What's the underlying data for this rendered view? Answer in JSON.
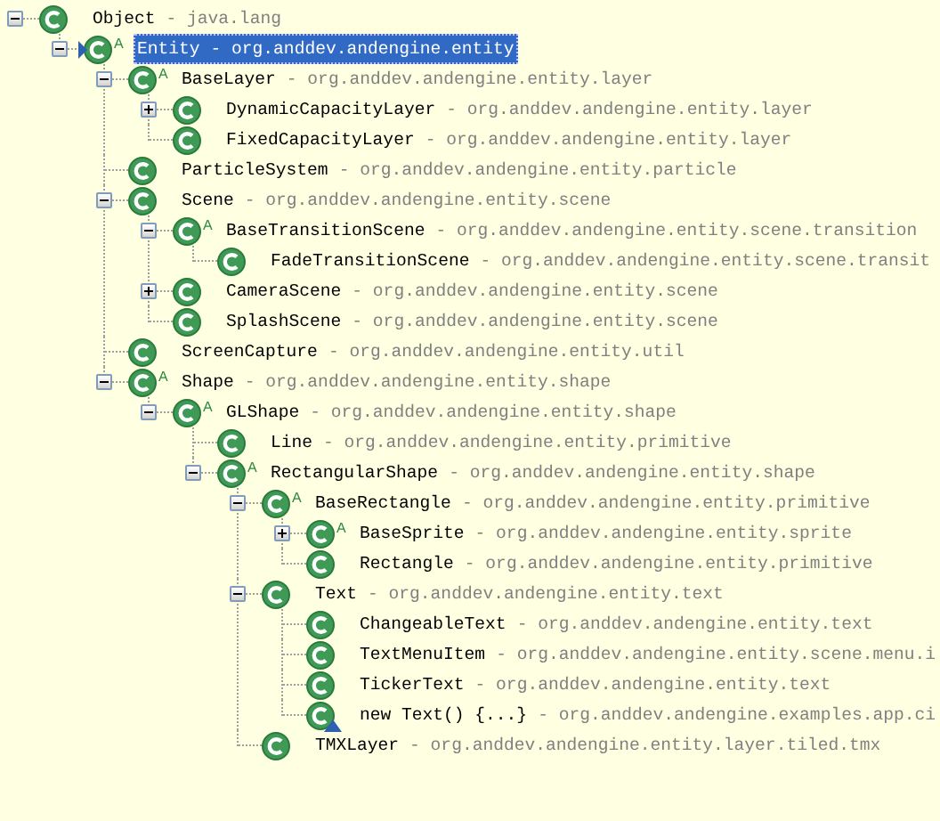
{
  "hierarchy": {
    "nodes": [
      {
        "name": "Object",
        "detail": "- java.lang",
        "kind": "class",
        "selected": false,
        "focused": false,
        "expanded": true,
        "children": [
          {
            "name": "Entity",
            "detail": "- org.anddev.andengine.entity",
            "kind": "class",
            "modifier": "A",
            "selected": true,
            "focused": true,
            "expanded": true,
            "children": [
              {
                "name": "BaseLayer",
                "detail": "- org.anddev.andengine.entity.layer",
                "kind": "class",
                "modifier": "A",
                "selected": false,
                "focused": false,
                "expanded": true,
                "children": [
                  {
                    "name": "DynamicCapacityLayer",
                    "detail": "- org.anddev.andengine.entity.layer",
                    "kind": "class",
                    "selected": false,
                    "focused": false,
                    "expanded": false
                  },
                  {
                    "name": "FixedCapacityLayer",
                    "detail": "- org.anddev.andengine.entity.layer",
                    "kind": "class",
                    "selected": false,
                    "focused": false
                  }
                ]
              },
              {
                "name": "ParticleSystem",
                "detail": "- org.anddev.andengine.entity.particle",
                "kind": "class",
                "selected": false,
                "focused": false
              },
              {
                "name": "Scene",
                "detail": "- org.anddev.andengine.entity.scene",
                "kind": "class",
                "selected": false,
                "focused": false,
                "expanded": true,
                "children": [
                  {
                    "name": "BaseTransitionScene",
                    "detail": "- org.anddev.andengine.entity.scene.transition",
                    "kind": "class",
                    "modifier": "A",
                    "selected": false,
                    "focused": false,
                    "expanded": true,
                    "children": [
                      {
                        "name": "FadeTransitionScene",
                        "detail": "- org.anddev.andengine.entity.scene.transit",
                        "kind": "class",
                        "selected": false,
                        "focused": false
                      }
                    ]
                  },
                  {
                    "name": "CameraScene",
                    "detail": "- org.anddev.andengine.entity.scene",
                    "kind": "class",
                    "selected": false,
                    "focused": false,
                    "expanded": false
                  },
                  {
                    "name": "SplashScene",
                    "detail": "- org.anddev.andengine.entity.scene",
                    "kind": "class",
                    "selected": false,
                    "focused": false
                  }
                ]
              },
              {
                "name": "ScreenCapture",
                "detail": "- org.anddev.andengine.entity.util",
                "kind": "class",
                "selected": false,
                "focused": false
              },
              {
                "name": "Shape",
                "detail": "- org.anddev.andengine.entity.shape",
                "kind": "class",
                "modifier": "A",
                "selected": false,
                "focused": false,
                "expanded": true,
                "children": [
                  {
                    "name": "GLShape",
                    "detail": "- org.anddev.andengine.entity.shape",
                    "kind": "class",
                    "modifier": "A",
                    "selected": false,
                    "focused": false,
                    "expanded": true,
                    "children": [
                      {
                        "name": "Line",
                        "detail": "- org.anddev.andengine.entity.primitive",
                        "kind": "class",
                        "selected": false,
                        "focused": false
                      },
                      {
                        "name": "RectangularShape",
                        "detail": "- org.anddev.andengine.entity.shape",
                        "kind": "class",
                        "modifier": "A",
                        "selected": false,
                        "focused": false,
                        "expanded": true,
                        "children": [
                          {
                            "name": "BaseRectangle",
                            "detail": "- org.anddev.andengine.entity.primitive",
                            "kind": "class",
                            "modifier": "A",
                            "selected": false,
                            "focused": false,
                            "expanded": true,
                            "children": [
                              {
                                "name": "BaseSprite",
                                "detail": "- org.anddev.andengine.entity.sprite",
                                "kind": "class",
                                "modifier": "A",
                                "selected": false,
                                "focused": false,
                                "expanded": false
                              },
                              {
                                "name": "Rectangle",
                                "detail": "- org.anddev.andengine.entity.primitive",
                                "kind": "class",
                                "selected": false,
                                "focused": false
                              }
                            ]
                          },
                          {
                            "name": "Text",
                            "detail": "- org.anddev.andengine.entity.text",
                            "kind": "class",
                            "selected": false,
                            "focused": false,
                            "expanded": true,
                            "children": [
                              {
                                "name": "ChangeableText",
                                "detail": "- org.anddev.andengine.entity.text",
                                "kind": "class",
                                "selected": false,
                                "focused": false
                              },
                              {
                                "name": "TextMenuItem",
                                "detail": "- org.anddev.andengine.entity.scene.menu.i",
                                "kind": "class",
                                "selected": false,
                                "focused": false
                              },
                              {
                                "name": "TickerText",
                                "detail": "- org.anddev.andengine.entity.text",
                                "kind": "class",
                                "selected": false,
                                "focused": false
                              },
                              {
                                "name": "new Text() {...}",
                                "detail": "- org.anddev.andengine.examples.app.ci",
                                "kind": "anonymous",
                                "selected": false,
                                "focused": false
                              }
                            ]
                          },
                          {
                            "name": "TMXLayer",
                            "detail": "- org.anddev.andengine.entity.layer.tiled.tmx",
                            "kind": "class",
                            "selected": false,
                            "focused": false
                          }
                        ]
                      }
                    ]
                  }
                ]
              }
            ]
          }
        ]
      }
    ]
  }
}
